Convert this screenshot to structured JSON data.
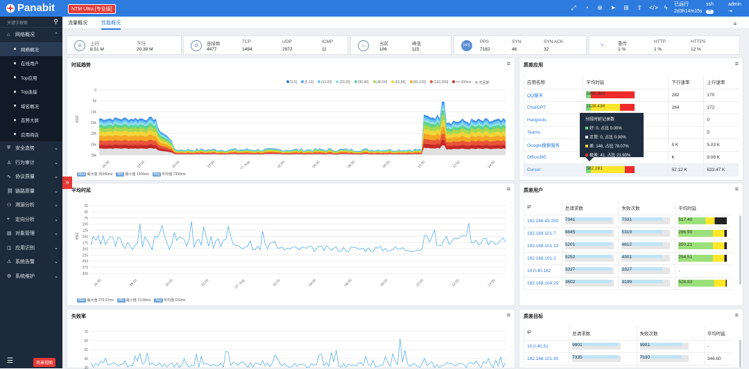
{
  "brand": {
    "name": "Panabit",
    "edition": "NTM Ultra [专业版]"
  },
  "header": {
    "runtime_label": "已运行",
    "runtime_value": "2d3h14m15s",
    "ssh_label": "ssh",
    "ssh_badge": "开",
    "admin_label": "admin",
    "admin_icon": "logout-icon"
  },
  "sidebar": {
    "search_placeholder": "关键字搜索",
    "menu": [
      {
        "label": "网络概况",
        "icon": "home-icon",
        "expanded": true,
        "subs": [
          "网络概况",
          "在线用户",
          "Top应用",
          "Top连接",
          "域名概况",
          "态势大屏",
          "应用商店"
        ]
      },
      {
        "label": "安全态势",
        "icon": "shield-icon"
      },
      {
        "label": "行为审计",
        "icon": "user-audit-icon"
      },
      {
        "label": "协议质量",
        "icon": "pulse-icon"
      },
      {
        "label": "链路质量",
        "icon": "link-icon"
      },
      {
        "label": "溯源分析",
        "icon": "trace-icon"
      },
      {
        "label": "定向分析",
        "icon": "location-icon"
      },
      {
        "label": "对象管理",
        "icon": "object-icon"
      },
      {
        "label": "应用识别",
        "icon": "app-icon"
      },
      {
        "label": "系统告警",
        "icon": "bell-icon"
      },
      {
        "label": "系统维护",
        "icon": "gear-icon"
      }
    ],
    "scene_button": "场景视图"
  },
  "tabs": [
    "流量概况",
    "性能概况"
  ],
  "stats": [
    {
      "icon": "traffic-icon",
      "items": [
        {
          "l": "上行",
          "v": "8.51 M"
        },
        {
          "l": "下行",
          "v": "20.39 M"
        }
      ]
    },
    {
      "icon": "connection-icon",
      "items": [
        {
          "l": "连接数",
          "v": "4477"
        },
        {
          "l": "TCP",
          "v": "1494"
        },
        {
          "l": "UDP",
          "v": "2972"
        },
        {
          "l": "ICMP",
          "v": "11"
        }
      ]
    },
    {
      "icon": "users-icon",
      "items": [
        {
          "l": "当前",
          "v": "106"
        },
        {
          "l": "峰值",
          "v": "115"
        }
      ]
    },
    {
      "icon": "pps-icon",
      "items": [
        {
          "l": "PPS",
          "v": "7182"
        },
        {
          "l": "SYN",
          "v": "46"
        },
        {
          "l": "SYN ACK",
          "v": "32"
        }
      ]
    },
    {
      "icon": "heartbeat-icon",
      "items": [
        {
          "l": "重传",
          "v": "1 %"
        },
        {
          "l": "HTTP",
          "v": "1 %"
        },
        {
          "l": "HTTPS",
          "v": "12 %"
        }
      ]
    }
  ],
  "latency_trend": {
    "title": "时延趋势",
    "ylabel": "时间",
    "legend": [
      {
        "l": "(0,5]",
        "c": "#2e7be0"
      },
      {
        "l": "(5,10]",
        "c": "#4aa0f0"
      },
      {
        "l": "(10,20]",
        "c": "#6cc4f5"
      },
      {
        "l": "(20,30]",
        "c": "#8fe0e8"
      },
      {
        "l": "(30,40]",
        "c": "#5fd38a"
      },
      {
        "l": "(40,50]",
        "c": "#a6d94f"
      },
      {
        "l": "(50,60]",
        "c": "#f2d43b"
      },
      {
        "l": "(60,120]",
        "c": "#f5a623"
      },
      {
        "l": "(120,200]",
        "c": "#e8553a"
      },
      {
        "l": "<= 300ms",
        "c": "#c62828"
      },
      {
        "l": "无回复",
        "c": "#bbbbbb"
      }
    ],
    "yticks": [
      "30k",
      "25k",
      "20k",
      "15k",
      "10k",
      "5k",
      "0"
    ],
    "xticks": [
      "16:00",
      "18:00",
      "20:00",
      "22:00",
      "27. Aug",
      "02:00",
      "04:00",
      "06:00",
      "08:00",
      "10:00",
      "12:00",
      "14:00"
    ],
    "footer": [
      {
        "tag": "Max",
        "l": "最大值 35346ms"
      },
      {
        "tag": "Min",
        "l": "最小值 1506ms"
      },
      {
        "tag": "Avg",
        "l": "平均值 7393ms"
      }
    ]
  },
  "avg_latency": {
    "title": "平均时延",
    "ylabel": "时间",
    "yticks": [
      "300",
      "275",
      "250",
      "225",
      "200",
      "175",
      "150",
      "125",
      "100",
      "75",
      "50",
      "25"
    ],
    "xticks": [
      "16:00",
      "18:00",
      "20:00",
      "22:00",
      "27. Aug",
      "02:00",
      "04:00",
      "06:00",
      "08:00",
      "10:00",
      "12:00",
      "14:00"
    ],
    "footer": [
      {
        "tag": "Max",
        "l": "最大值 279.57ms"
      },
      {
        "tag": "Min",
        "l": "最小值 73.58ms"
      },
      {
        "tag": "Avg",
        "l": "平均值 150ms"
      }
    ]
  },
  "fail_rate": {
    "title": "失败率",
    "yticks": [
      "70",
      "60",
      "50",
      "40",
      "30"
    ]
  },
  "quality_apps": {
    "title": "质差应用",
    "headers": [
      "应用名称",
      "平均时延",
      "下行速率",
      "上行速率"
    ],
    "rows": [
      {
        "n": "QQ聊天",
        "lat": "2490.863",
        "g": 0.1,
        "y": 0.0,
        "r": 0.9,
        "dn": "282",
        "up": "170"
      },
      {
        "n": "ChatGPT",
        "lat": "1128.438",
        "g": 0.1,
        "y": 0.6,
        "r": 0.3,
        "dn": "284",
        "up": "172"
      },
      {
        "n": "Hangouts",
        "lat": "",
        "g": 0,
        "y": 0,
        "r": 0,
        "dn": "",
        "up": "0"
      },
      {
        "n": "Teams",
        "lat": "",
        "g": 0,
        "y": 0,
        "r": 0,
        "dn": "",
        "up": "0"
      },
      {
        "n": "Google搜索服务",
        "lat": "",
        "g": 0,
        "y": 0,
        "r": 0,
        "dn": "5 K",
        "up": "5.03 K"
      },
      {
        "n": "Office365",
        "lat": "",
        "g": 0,
        "y": 0,
        "r": 0,
        "dn": "K",
        "up": "9.08 K"
      },
      {
        "n": "Cursor",
        "lat": "582.281",
        "g": 0.1,
        "y": 0.7,
        "r": 0.2,
        "dn": "52.12 K",
        "up": "633.47 K"
      }
    ],
    "tooltip": {
      "title": "分段时延记录数",
      "lines": [
        {
          "c": "#5fd38a",
          "l": "好: 0, 占比 0.00%"
        },
        {
          "c": "#ffffff",
          "l": "正常: 0, 占比 0.00%"
        },
        {
          "c": "#f2d43b",
          "l": "差: 146, 占比 78.07%"
        },
        {
          "c": "#e53935",
          "l": "极差: 41, 占比 21.93%"
        }
      ]
    }
  },
  "quality_users": {
    "title": "质差用户",
    "headers": [
      "IP",
      "总请求数",
      "失败次数",
      "平均时延"
    ],
    "rows": [
      {
        "ip": "192.168.45.250",
        "req": "7341",
        "fail": "7331",
        "lat": "517.40",
        "yp": 0.75
      },
      {
        "ip": "192.168.101.7",
        "req": "6845",
        "fail": "5319",
        "lat": "266.90",
        "yp": 0.95
      },
      {
        "ip": "192.168.101.13",
        "req": "5201",
        "fail": "4812",
        "lat": "350.21",
        "yp": 0.95
      },
      {
        "ip": "192.168.101.3",
        "req": "5252",
        "fail": "4301",
        "lat": "254.51",
        "yp": 0.95
      },
      {
        "ip": "10.0.40.182",
        "req": "3327",
        "fail": "3327",
        "lat": "-",
        "yp": 0
      },
      {
        "ip": "192.168.104.29",
        "req": "3602",
        "fail": "3199",
        "lat": "528.83",
        "yp": 0.98
      }
    ]
  },
  "quality_targets": {
    "title": "质差目标",
    "headers": [
      "IP",
      "总请求数",
      "失败次数",
      "平均时延"
    ],
    "rows": [
      {
        "ip": "10.0.40.51",
        "req": "9901",
        "fail": "9901",
        "lat": "-"
      },
      {
        "ip": "192.168.101.30",
        "req": "7335",
        "fail": "7330",
        "lat": "346.60"
      }
    ]
  }
}
